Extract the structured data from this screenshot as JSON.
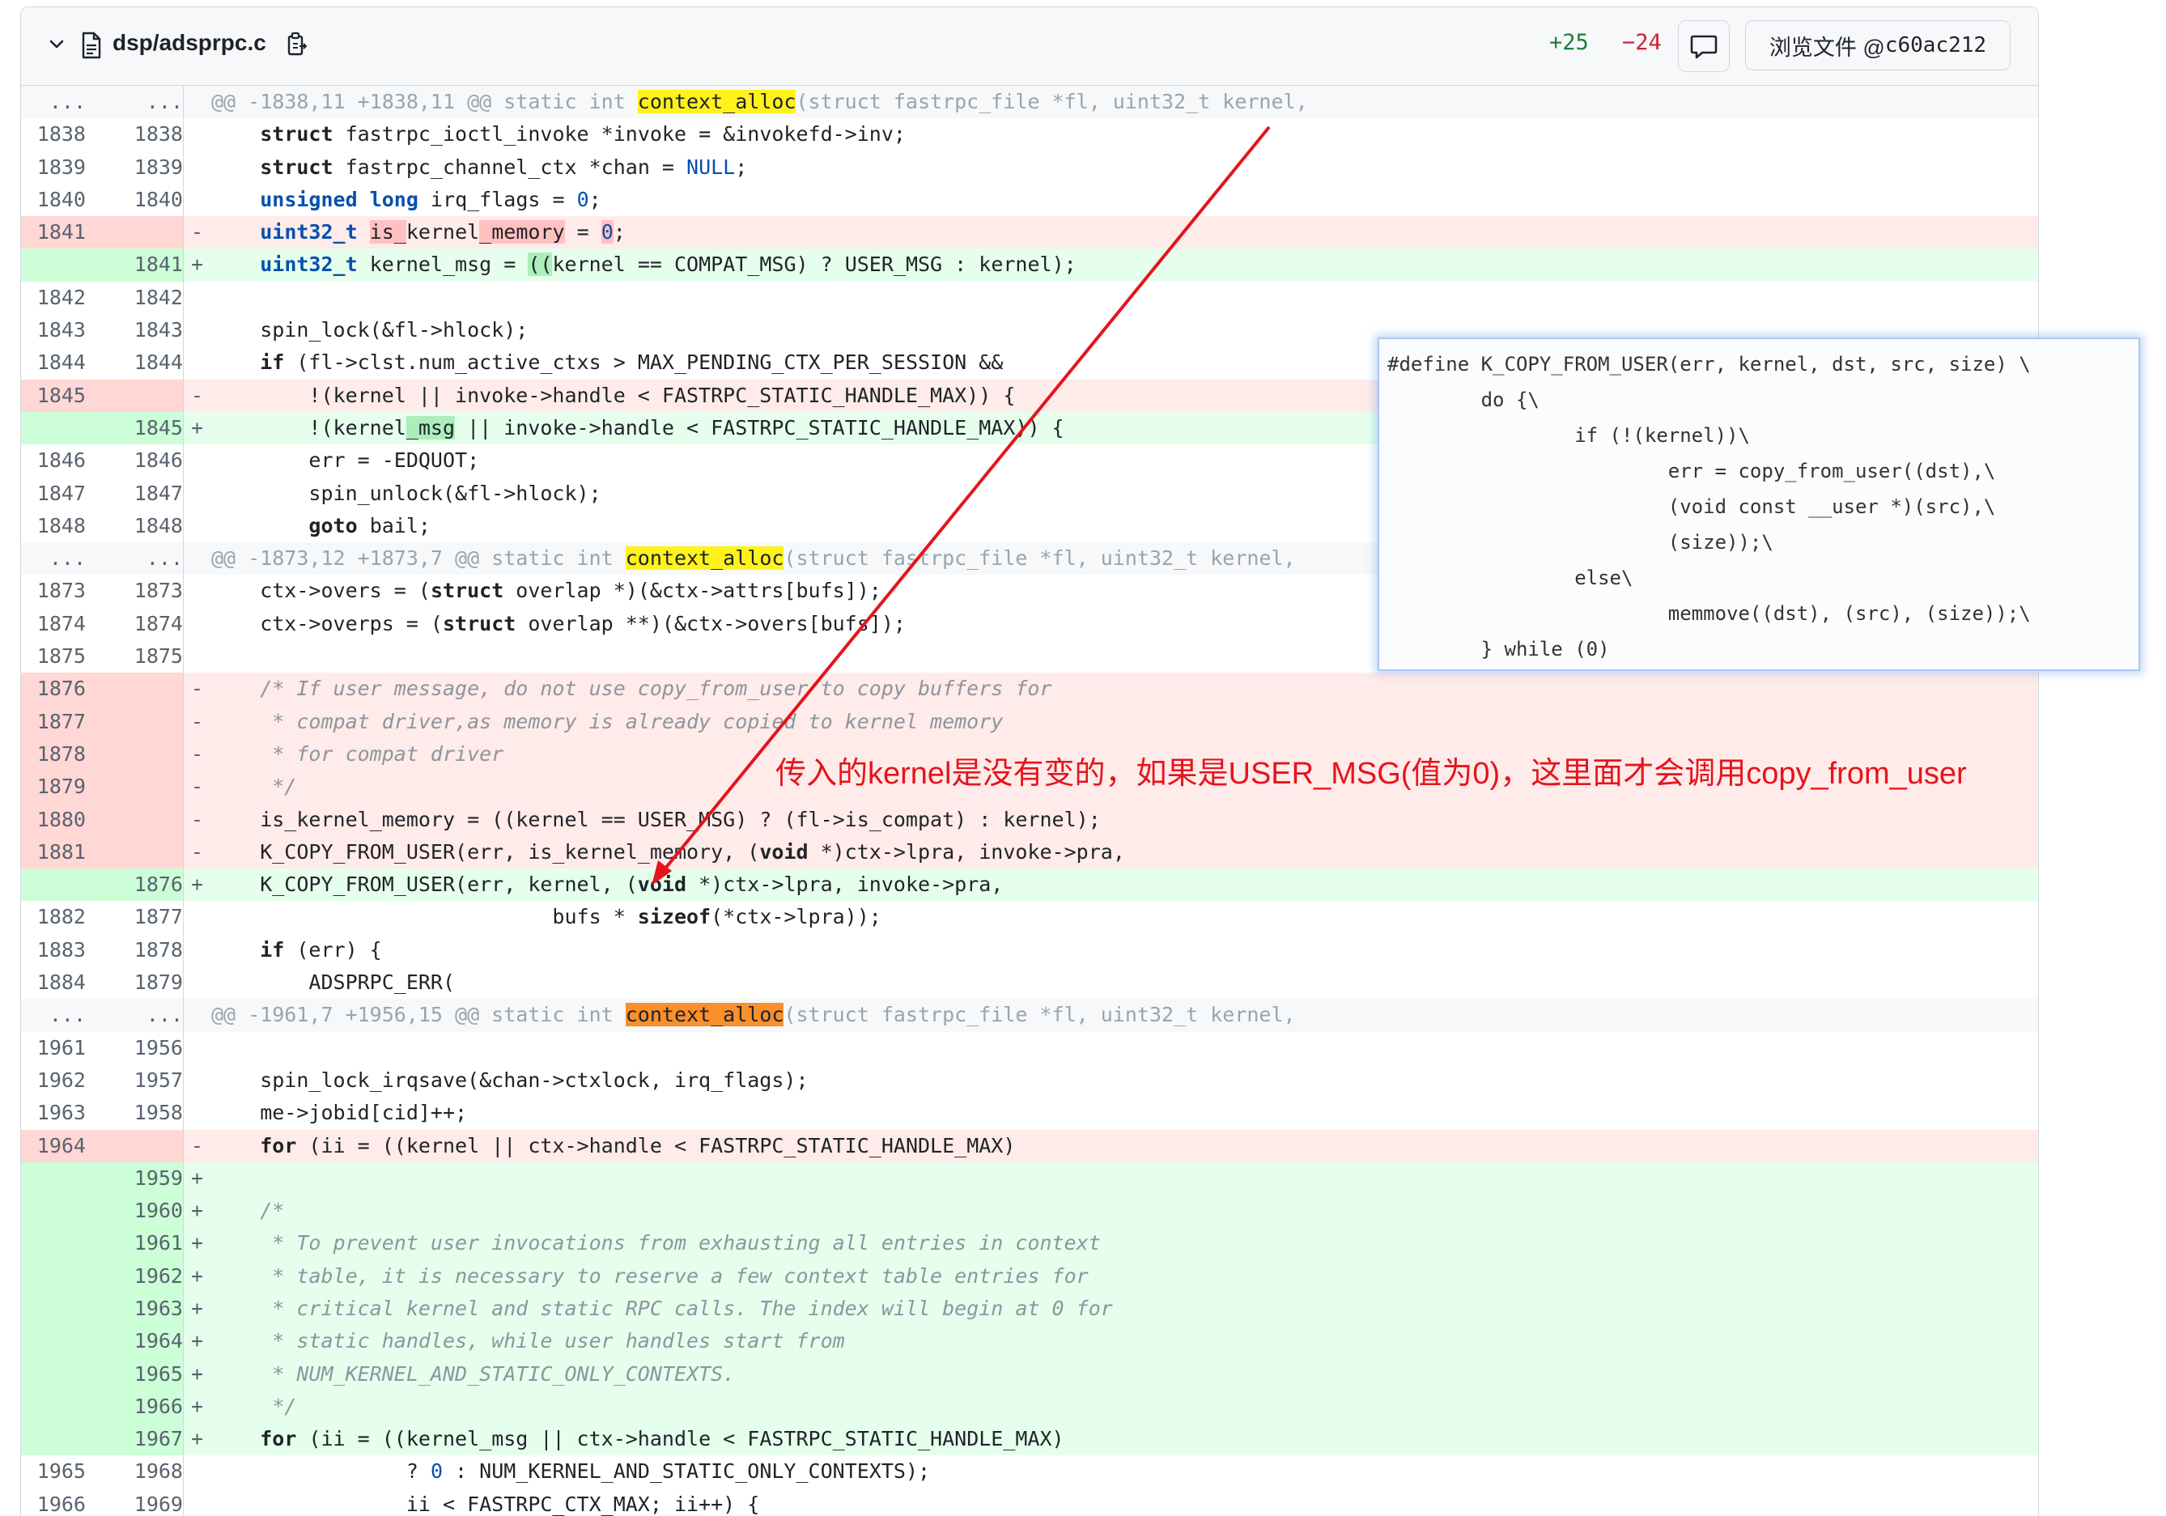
{
  "header": {
    "file_path": "dsp/adsprpc.c",
    "additions": "+25",
    "deletions": "−24",
    "browse_label": "浏览文件 @ ",
    "commit": "c60ac212"
  },
  "rows": [
    {
      "t": "hunk",
      "o": "...",
      "n": "...",
      "code": "@@ -1838,11 +1838,11 @@ static int |context_alloc|(struct fastrpc_file *fl, uint32_t kernel,",
      "hl": "y"
    },
    {
      "t": "ctx",
      "o": "1838",
      "n": "1838",
      "code": "\tstruct fastrpc_ioctl_invoke *invoke = &invokefd->inv;"
    },
    {
      "t": "ctx",
      "o": "1839",
      "n": "1839",
      "code": "\tstruct fastrpc_channel_ctx *chan = NULL;"
    },
    {
      "t": "ctx",
      "o": "1840",
      "n": "1840",
      "code": "\tunsigned long irq_flags = 0;"
    },
    {
      "t": "del",
      "o": "1841",
      "n": "",
      "code": "\tuint32_t is_kernel_memory = 0;"
    },
    {
      "t": "add",
      "o": "",
      "n": "1841",
      "code": "\tuint32_t kernel_msg = ((kernel == COMPAT_MSG) ? USER_MSG : kernel);"
    },
    {
      "t": "ctx",
      "o": "1842",
      "n": "1842",
      "code": ""
    },
    {
      "t": "ctx",
      "o": "1843",
      "n": "1843",
      "code": "\tspin_lock(&fl->hlock);"
    },
    {
      "t": "ctx",
      "o": "1844",
      "n": "1844",
      "code": "\tif (fl->clst.num_active_ctxs > MAX_PENDING_CTX_PER_SESSION &&"
    },
    {
      "t": "del",
      "o": "1845",
      "n": "",
      "code": "\t\t!(kernel || invoke->handle < FASTRPC_STATIC_HANDLE_MAX)) {"
    },
    {
      "t": "add",
      "o": "",
      "n": "1845",
      "code": "\t\t!(kernel_msg || invoke->handle < FASTRPC_STATIC_HANDLE_MAX)) {"
    },
    {
      "t": "ctx",
      "o": "1846",
      "n": "1846",
      "code": "\t\terr = -EDQUOT;"
    },
    {
      "t": "ctx",
      "o": "1847",
      "n": "1847",
      "code": "\t\tspin_unlock(&fl->hlock);"
    },
    {
      "t": "ctx",
      "o": "1848",
      "n": "1848",
      "code": "\t\tgoto bail;"
    },
    {
      "t": "hunk",
      "o": "...",
      "n": "...",
      "code": "@@ -1873,12 +1873,7 @@ static int |context_alloc|(struct fastrpc_file *fl, uint32_t kernel,",
      "hl": "y"
    },
    {
      "t": "ctx",
      "o": "1873",
      "n": "1873",
      "code": "\tctx->overs = (struct overlap *)(&ctx->attrs[bufs]);"
    },
    {
      "t": "ctx",
      "o": "1874",
      "n": "1874",
      "code": "\tctx->overps = (struct overlap **)(&ctx->overs[bufs]);"
    },
    {
      "t": "ctx",
      "o": "1875",
      "n": "1875",
      "code": ""
    },
    {
      "t": "del",
      "o": "1876",
      "n": "",
      "code": "\t/* If user message, do not use copy_from_user to copy buffers for"
    },
    {
      "t": "del",
      "o": "1877",
      "n": "",
      "code": "\t * compat driver,as memory is already copied to kernel memory"
    },
    {
      "t": "del",
      "o": "1878",
      "n": "",
      "code": "\t * for compat driver"
    },
    {
      "t": "del",
      "o": "1879",
      "n": "",
      "code": "\t */"
    },
    {
      "t": "del",
      "o": "1880",
      "n": "",
      "code": "\tis_kernel_memory = ((kernel == USER_MSG) ? (fl->is_compat) : kernel);"
    },
    {
      "t": "del",
      "o": "1881",
      "n": "",
      "code": "\tK_COPY_FROM_USER(err, is_kernel_memory, (void *)ctx->lpra, invoke->pra,"
    },
    {
      "t": "add",
      "o": "",
      "n": "1876",
      "code": "\tK_COPY_FROM_USER(err, kernel, (void *)ctx->lpra, invoke->pra,"
    },
    {
      "t": "ctx",
      "o": "1882",
      "n": "1877",
      "code": "\t\t\t\t\t\t\tbufs * sizeof(*ctx->lpra));"
    },
    {
      "t": "ctx",
      "o": "1883",
      "n": "1878",
      "code": "\tif (err) {"
    },
    {
      "t": "ctx",
      "o": "1884",
      "n": "1879",
      "code": "\t\tADSPRPC_ERR("
    },
    {
      "t": "hunk",
      "o": "...",
      "n": "...",
      "code": "@@ -1961,7 +1956,15 @@ static int |context_alloc|(struct fastrpc_file *fl, uint32_t kernel,",
      "hl": "o"
    },
    {
      "t": "ctx",
      "o": "1961",
      "n": "1956",
      "code": ""
    },
    {
      "t": "ctx",
      "o": "1962",
      "n": "1957",
      "code": "\tspin_lock_irqsave(&chan->ctxlock, irq_flags);"
    },
    {
      "t": "ctx",
      "o": "1963",
      "n": "1958",
      "code": "\tme->jobid[cid]++;"
    },
    {
      "t": "del",
      "o": "1964",
      "n": "",
      "code": "\tfor (ii = ((kernel || ctx->handle < FASTRPC_STATIC_HANDLE_MAX)"
    },
    {
      "t": "add",
      "o": "",
      "n": "1959",
      "code": ""
    },
    {
      "t": "add",
      "o": "",
      "n": "1960",
      "code": "\t/*"
    },
    {
      "t": "add",
      "o": "",
      "n": "1961",
      "code": "\t * To prevent user invocations from exhausting all entries in context"
    },
    {
      "t": "add",
      "o": "",
      "n": "1962",
      "code": "\t * table, it is necessary to reserve a few context table entries for"
    },
    {
      "t": "add",
      "o": "",
      "n": "1963",
      "code": "\t * critical kernel and static RPC calls. The index will begin at 0 for"
    },
    {
      "t": "add",
      "o": "",
      "n": "1964",
      "code": "\t * static handles, while user handles start from"
    },
    {
      "t": "add",
      "o": "",
      "n": "1965",
      "code": "\t * NUM_KERNEL_AND_STATIC_ONLY_CONTEXTS."
    },
    {
      "t": "add",
      "o": "",
      "n": "1966",
      "code": "\t */"
    },
    {
      "t": "add",
      "o": "",
      "n": "1967",
      "code": "\tfor (ii = ((kernel_msg || ctx->handle < FASTRPC_STATIC_HANDLE_MAX)"
    },
    {
      "t": "ctx",
      "o": "1965",
      "n": "1968",
      "code": "\t\t\t\t? 0 : NUM_KERNEL_AND_STATIC_ONLY_CONTEXTS);"
    },
    {
      "t": "ctx",
      "o": "1966",
      "n": "1969",
      "code": "\t\t\t\tii < FASTRPC_CTX_MAX; ii++) {"
    }
  ],
  "macro_box": [
    "#define K_COPY_FROM_USER(err, kernel, dst, src, size) \\",
    "        do {\\",
    "                if (!(kernel))\\",
    "                        err = copy_from_user((dst),\\",
    "                        (void const __user *)(src),\\",
    "                        (size));\\",
    "                else\\",
    "                        memmove((dst), (src), (size));\\",
    "        } while (0)"
  ],
  "annotation": "传入的kernel是没有变的，如果是USER_MSG(值为0)，这里面才会调用copy_from_user",
  "colors": {
    "annotation_red": "#e5141c",
    "add": "#e6ffec",
    "del": "#ffebe9"
  },
  "icons": [
    "chevron-down-icon",
    "file-icon",
    "copy-icon",
    "comment-icon"
  ]
}
